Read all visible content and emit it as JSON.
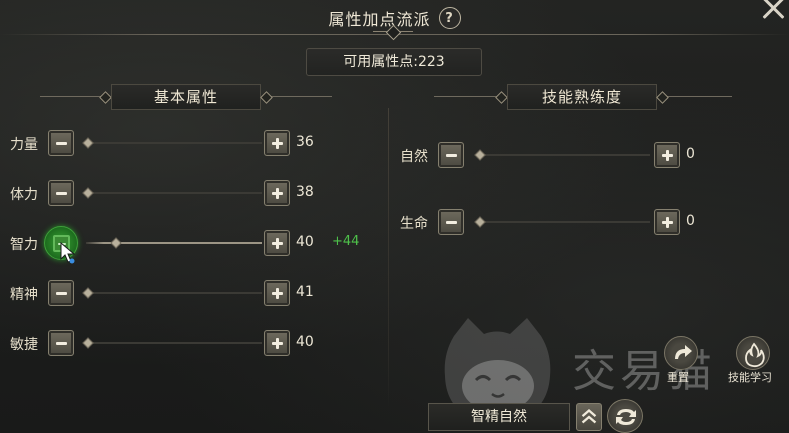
{
  "window": {
    "title": "属性加点流派",
    "help_icon": "question-circle-icon",
    "close_icon": "close-icon"
  },
  "points": {
    "label": "可用属性点:223"
  },
  "basic": {
    "header": "基本属性",
    "rows": [
      {
        "label": "力量",
        "value": "36",
        "bonus": "",
        "fill": 0.0
      },
      {
        "label": "体力",
        "value": "38",
        "bonus": "",
        "fill": 0.0
      },
      {
        "label": "智力",
        "value": "40",
        "bonus": "+44",
        "fill": 0.16
      },
      {
        "label": "精神",
        "value": "41",
        "bonus": "",
        "fill": 0.0
      },
      {
        "label": "敏捷",
        "value": "40",
        "bonus": "",
        "fill": 0.0
      }
    ]
  },
  "skills": {
    "header": "技能熟练度",
    "rows": [
      {
        "label": "自然",
        "value": "0"
      },
      {
        "label": "生命",
        "value": "0"
      }
    ]
  },
  "actions": {
    "reset_label": "重置",
    "skill_learn_label": "技能学习"
  },
  "watermark": {
    "text": "交易猫"
  },
  "bottom": {
    "scheme_name": "智精自然"
  },
  "colors": {
    "bonus": "#4ec14a",
    "active_button": "#2c8a2a"
  }
}
